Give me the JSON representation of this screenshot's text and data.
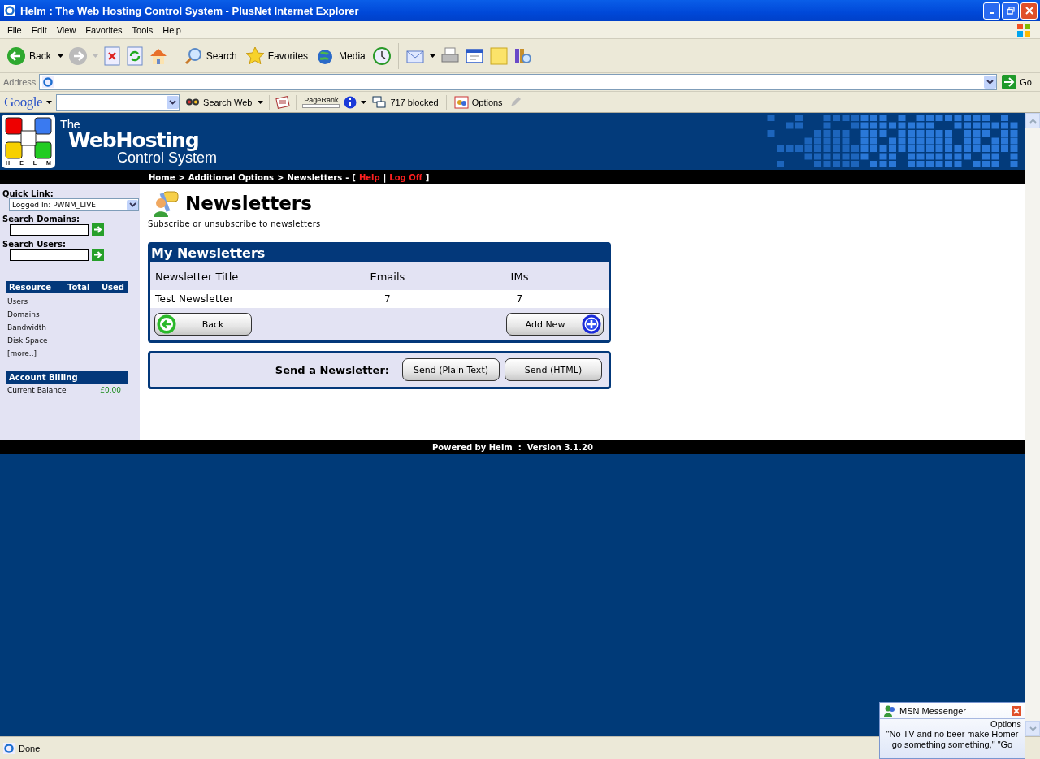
{
  "window": {
    "title": "Helm : The Web Hosting Control System - PlusNet Internet Explorer"
  },
  "menu": [
    "File",
    "Edit",
    "View",
    "Favorites",
    "Tools",
    "Help"
  ],
  "toolbar": {
    "back": "Back",
    "search": "Search",
    "favorites": "Favorites",
    "media": "Media"
  },
  "address": {
    "label": "Address",
    "go": "Go"
  },
  "google_bar": {
    "logo": "Google",
    "search_web": "Search Web",
    "pagerank": "PageRank",
    "blocked": "717 blocked",
    "options": "Options"
  },
  "header": {
    "logo_letters": [
      "H",
      "E",
      "L",
      "M"
    ],
    "line_1": "The",
    "line_2": "WebHosting",
    "line_3": "Control System"
  },
  "breadcrumb": {
    "items": [
      "Home",
      "Additional Options",
      "Newsletters"
    ],
    "separator": ">",
    "dash": "-",
    "open": "[",
    "links": [
      "Help",
      "Log Off"
    ],
    "divider": "|",
    "close": "]"
  },
  "sidebar": {
    "quick_link_label": "Quick Link:",
    "quick_link_value": "Logged In: PWNM_LIVE",
    "search_domains_label": "Search Domains:",
    "search_users_label": "Search Users:",
    "resource_columns": [
      "Resource",
      "Total",
      "Used"
    ],
    "resources": [
      "Users",
      "Domains",
      "Bandwidth",
      "Disk Space"
    ],
    "more": "[more..]",
    "billing_title": "Account Billing",
    "balance_label": "Current Balance",
    "balance_value": "£0.00"
  },
  "content": {
    "title": "Newsletters",
    "subtitle": "Subscribe or unsubscribe to newsletters",
    "panel_title": "My Newsletters",
    "columns": [
      "Newsletter Title",
      "Emails",
      "IMs"
    ],
    "rows": [
      {
        "title": "Test Newsletter",
        "emails": "7",
        "ims": "7"
      }
    ],
    "back_button": "Back",
    "add_button": "Add New",
    "send_label": "Send a Newsletter:",
    "send_buttons": [
      "Send (Plain Text)",
      "Send (HTML)"
    ]
  },
  "footer": "Powered by Helm  :  Version 3.1.20",
  "status_bar": {
    "text": "Done"
  },
  "msn_popup": {
    "title": "MSN Messenger",
    "options": "Options",
    "message": "\"No TV and no beer make Homer go something something,\" \"Go"
  }
}
